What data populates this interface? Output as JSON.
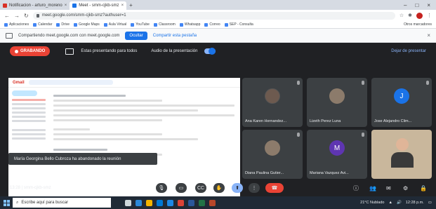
{
  "browser": {
    "tabs": [
      {
        "label": "Notificacion - arturo_moreno",
        "active": false
      },
      {
        "label": "Meet - smm-cjkb-smz",
        "active": true
      }
    ],
    "new_tab": "+",
    "url": "meet.google.com/smm-cjkb-smz?authuser=1",
    "bookmarks": [
      "Aplicaciones",
      "Calendar",
      "Drive",
      "Google Maps",
      "Aula Virtual",
      "YouTube",
      "Classroom",
      "Whatsapp",
      "Correo",
      "SEP - Consulta"
    ],
    "bookmarks_more": "Otros marcadores"
  },
  "infobar": {
    "text": "Compartiendo meet.google.com con meet.google.com",
    "share_button": "Ocultar",
    "more_link": "Compartir esta pestaña"
  },
  "meet": {
    "record_label": "GRABANDO",
    "present_label": "Estas presentando para todos",
    "audio_label": "Audio de la presentación",
    "stop_label": "Dejar de presentar",
    "toast": "María Georgina Bello Cubroza ha abandonado la reunión",
    "meeting_code": "13:28  |  smm-cjkb-smz",
    "participants": [
      {
        "name": "Ana Karen Hernandez...",
        "avatar": "photo"
      },
      {
        "name": "Lizeth Perez Luna",
        "avatar": "photo"
      },
      {
        "name": "Jose Alejandro Clim...",
        "avatar": "J"
      },
      {
        "name": "Diana Paulina Gutier...",
        "avatar": "photo"
      },
      {
        "name": "Mariana Vazquez Avi...",
        "avatar": "M"
      },
      {
        "name": "",
        "avatar": "camera"
      }
    ]
  },
  "gmail": {
    "logo": "Gmail"
  },
  "taskbar": {
    "search_placeholder": "Escribe aquí para buscar",
    "tray_text": "21°C Nublado",
    "clock": "12:28 p.m."
  },
  "colors": {
    "record": "#ea4335",
    "accent": "#1a73e8",
    "meet_bg": "#202124"
  }
}
